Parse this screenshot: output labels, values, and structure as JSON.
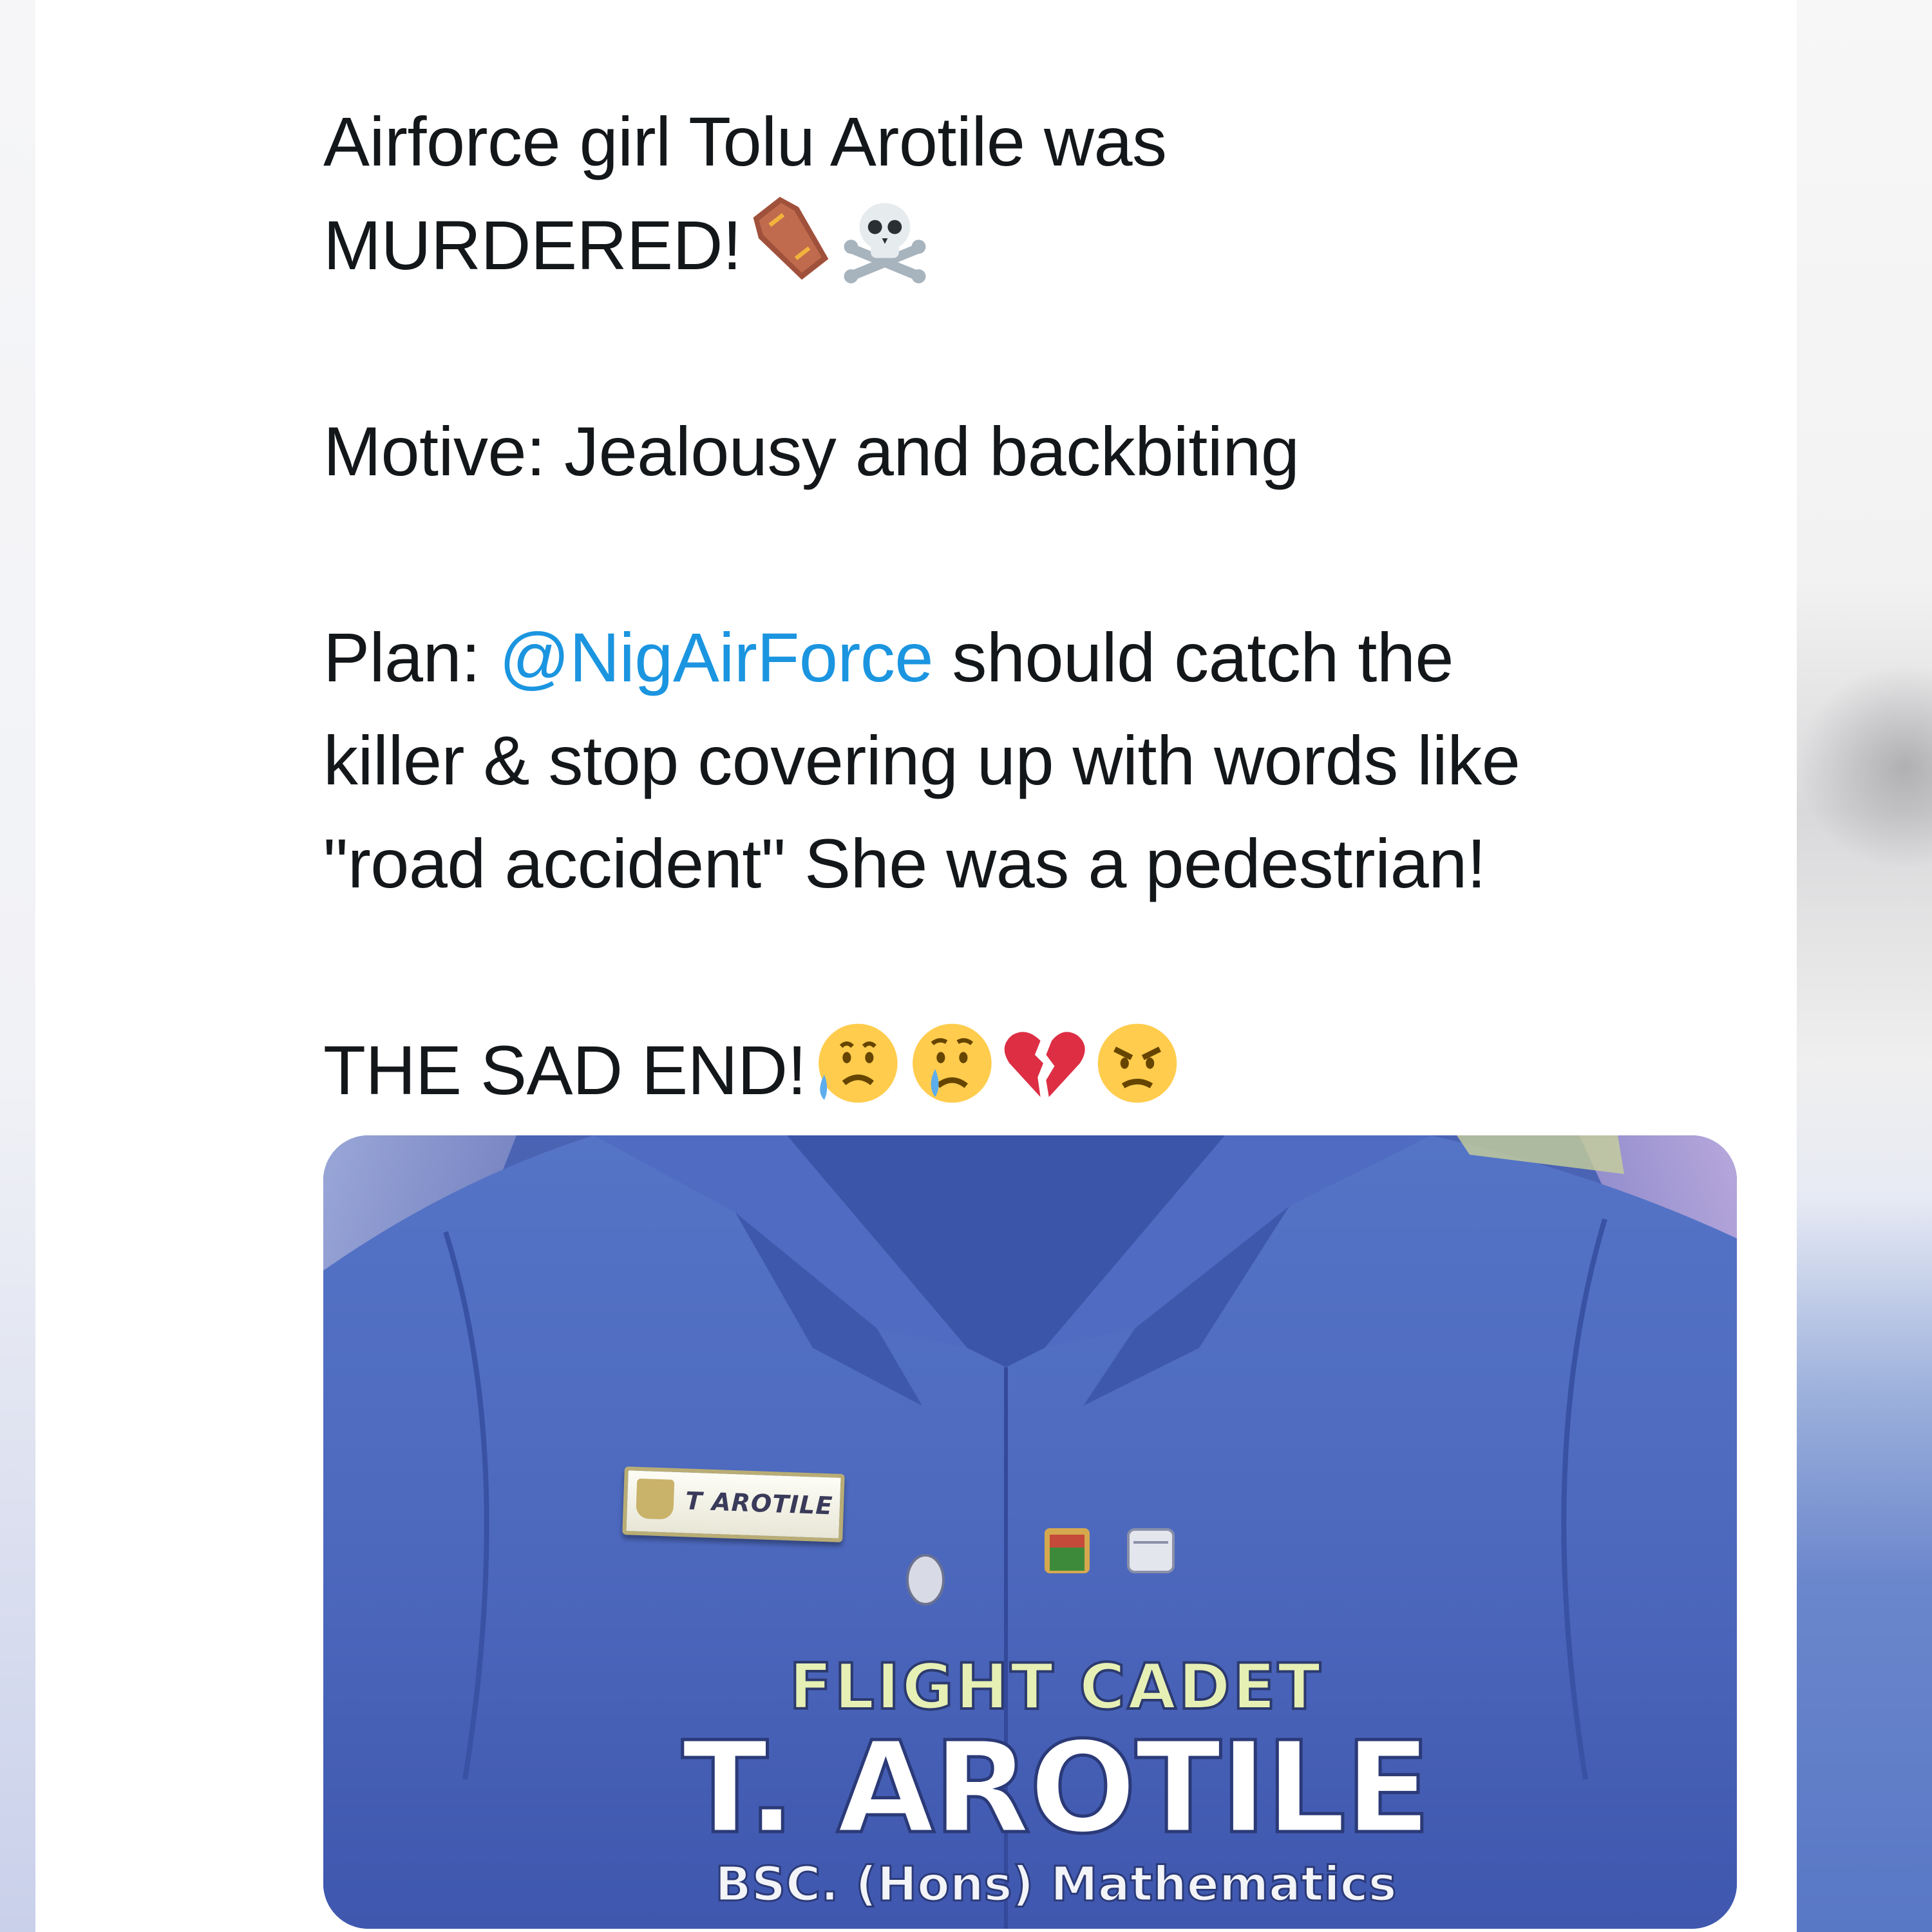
{
  "tweet": {
    "line1": "Airforce girl Tolu Arotile was",
    "line2": "MURDERED!",
    "line2_emojis": [
      "coffin-emoji",
      "skull-and-crossbones-emoji"
    ],
    "motive": "Motive: Jealousy and backbiting",
    "plan_prefix": "Plan: ",
    "plan_mention": "@NigAirForce",
    "plan_rest_line1": " should catch the",
    "plan_line2": "killer & stop covering up with words like",
    "plan_line3": "\"road accident\" She was a pedestrian!",
    "ending": "THE SAD END!",
    "ending_emojis": [
      "sad-but-relieved-face-emoji",
      "crying-face-emoji",
      "broken-heart-emoji",
      "angry-face-emoji"
    ]
  },
  "media": {
    "name_tag": "T AROTILE",
    "rank": "FLIGHT CADET",
    "name": "T. AROTILE",
    "degree": "BSC. (Hons) Mathematics"
  },
  "colors": {
    "text": "#14171a",
    "mention": "#1b95e0",
    "uniform": "#4a64b4",
    "caption_rank": "#e7f0b4"
  }
}
